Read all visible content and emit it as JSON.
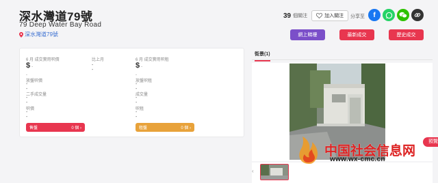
{
  "header": {
    "title": "深水灣道79號",
    "subtitle": "79 Deep Water Bay Road",
    "location": "深水灣道79號"
  },
  "follow": {
    "count": "39",
    "count_label": "個關注",
    "button_label": "加入關注"
  },
  "share": {
    "label": "分享至",
    "icons": [
      "facebook-icon",
      "whatsapp-icon",
      "wechat-icon",
      "link-icon"
    ],
    "colors": [
      "#1877f2",
      "#25d366",
      "#2dc100",
      "#333333"
    ]
  },
  "actions": [
    {
      "label": "網上睇樓",
      "color": "#7b4fc9"
    },
    {
      "label": "最新成交",
      "color": "#e8364f"
    },
    {
      "label": "歷史成交",
      "color": "#e8364f"
    }
  ],
  "stats": {
    "sale": {
      "month_label": "6 月 成交實用呎價",
      "price": "$",
      "price_suffix": "--",
      "compare_label": "比上月",
      "compare_value": "- -",
      "listing_label": "放盤呎價",
      "listing_value": "--",
      "count_label": "二手成交量",
      "count_value": "--",
      "price2_label": "呎價",
      "price2_value": "--",
      "pill_label": "售盤",
      "pill_count": "0 個 ›",
      "pill_color": "#e8364f"
    },
    "rent": {
      "month_label": "6 月 成交實用呎租",
      "price": "$",
      "price_suffix": "--",
      "listing_label": "放盤呎租",
      "listing_value": "--",
      "count_label": "成交量",
      "count_value": "--",
      "price2_label": "呎租",
      "price2_value": "--",
      "pill_label": "租盤",
      "pill_count": "0 個 ›",
      "pill_color": "#e8a23a"
    }
  },
  "photos": {
    "tab_label": "街景(1)"
  },
  "watermark": {
    "text": "中国社会信息网",
    "url": "www.wx-cmc.cn",
    "side": "預覽"
  }
}
